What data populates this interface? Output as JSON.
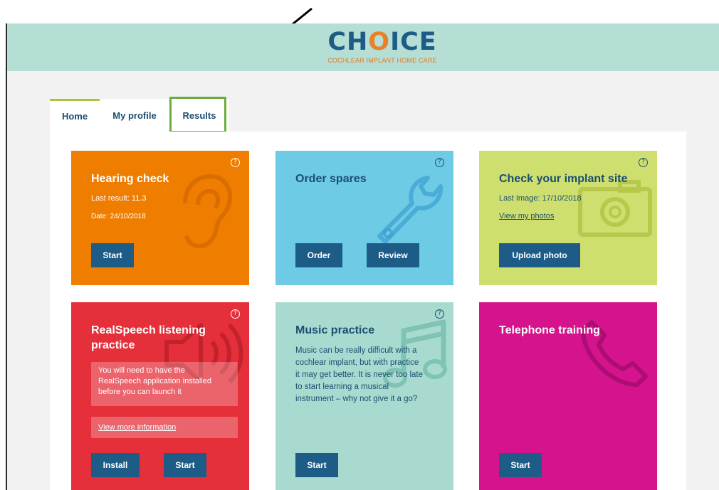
{
  "header": {
    "logo_word_before": "CH",
    "logo_o": "O",
    "logo_word_after": "ICE",
    "logo_subtitle": "COCHLEAR IMPLANT HOME CARE"
  },
  "tabs": [
    {
      "label": "Home",
      "active": true
    },
    {
      "label": "My profile",
      "active": false
    },
    {
      "label": "Results",
      "active": false,
      "highlighted": true
    }
  ],
  "cards": {
    "hearing": {
      "title": "Hearing check",
      "last_result": "Last result: 11.3",
      "date": "Date: 24/10/2018",
      "help": "?",
      "icon": "ear-icon",
      "start_label": "Start"
    },
    "spares": {
      "title": "Order spares",
      "help": "?",
      "icon": "wrench-icon",
      "order_label": "Order",
      "review_label": "Review"
    },
    "implant": {
      "title": "Check your implant site",
      "last_image": "Last Image: 17/10/2018",
      "view_photos": "View my photos",
      "help": "?",
      "icon": "camera-icon",
      "upload_label": "Upload photo"
    },
    "speech": {
      "title_line1": "RealSpeech listening",
      "title_line2": "practice",
      "note_line1": "You will need to have the",
      "note_line2": "RealSpeech application installed",
      "note_line3": "before you can launch it",
      "more_info": "View more information",
      "help": "?",
      "icon": "speaker-icon",
      "install_label": "Install",
      "start_label": "Start"
    },
    "music": {
      "title": "Music practice",
      "desc_line1": "Music can be really difficult with a",
      "desc_line2": "cochlear implant, but with practice",
      "desc_line3": "it may get better. It is never too late",
      "desc_line4": "to start learning a musical",
      "desc_line5": "instrument – why not give it a go?",
      "help": "?",
      "icon": "music-note-icon",
      "start_label": "Start"
    },
    "phone": {
      "title": "Telephone training",
      "icon": "phone-icon",
      "start_label": "Start"
    }
  },
  "colors": {
    "header_band": "#b5ded4",
    "brand_blue": "#1d5c87",
    "orange": "#ef7d00",
    "light_blue": "#6ecbe5",
    "lime": "#cfdf6f",
    "red": "#e52f3a",
    "mint": "#a8dacf",
    "magenta": "#d4138c",
    "highlight_green": "#6bad3c"
  }
}
